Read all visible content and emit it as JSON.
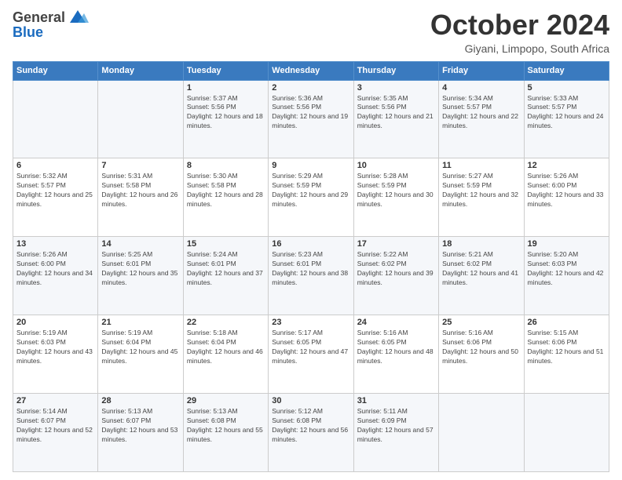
{
  "header": {
    "logo": {
      "line1": "General",
      "line2": "Blue"
    },
    "month": "October 2024",
    "location": "Giyani, Limpopo, South Africa"
  },
  "weekdays": [
    "Sunday",
    "Monday",
    "Tuesday",
    "Wednesday",
    "Thursday",
    "Friday",
    "Saturday"
  ],
  "weeks": [
    [
      null,
      null,
      {
        "day": 1,
        "sunrise": "5:37 AM",
        "sunset": "5:56 PM",
        "daylight": "12 hours and 18 minutes."
      },
      {
        "day": 2,
        "sunrise": "5:36 AM",
        "sunset": "5:56 PM",
        "daylight": "12 hours and 19 minutes."
      },
      {
        "day": 3,
        "sunrise": "5:35 AM",
        "sunset": "5:56 PM",
        "daylight": "12 hours and 21 minutes."
      },
      {
        "day": 4,
        "sunrise": "5:34 AM",
        "sunset": "5:57 PM",
        "daylight": "12 hours and 22 minutes."
      },
      {
        "day": 5,
        "sunrise": "5:33 AM",
        "sunset": "5:57 PM",
        "daylight": "12 hours and 24 minutes."
      }
    ],
    [
      {
        "day": 6,
        "sunrise": "5:32 AM",
        "sunset": "5:57 PM",
        "daylight": "12 hours and 25 minutes."
      },
      {
        "day": 7,
        "sunrise": "5:31 AM",
        "sunset": "5:58 PM",
        "daylight": "12 hours and 26 minutes."
      },
      {
        "day": 8,
        "sunrise": "5:30 AM",
        "sunset": "5:58 PM",
        "daylight": "12 hours and 28 minutes."
      },
      {
        "day": 9,
        "sunrise": "5:29 AM",
        "sunset": "5:59 PM",
        "daylight": "12 hours and 29 minutes."
      },
      {
        "day": 10,
        "sunrise": "5:28 AM",
        "sunset": "5:59 PM",
        "daylight": "12 hours and 30 minutes."
      },
      {
        "day": 11,
        "sunrise": "5:27 AM",
        "sunset": "5:59 PM",
        "daylight": "12 hours and 32 minutes."
      },
      {
        "day": 12,
        "sunrise": "5:26 AM",
        "sunset": "6:00 PM",
        "daylight": "12 hours and 33 minutes."
      }
    ],
    [
      {
        "day": 13,
        "sunrise": "5:26 AM",
        "sunset": "6:00 PM",
        "daylight": "12 hours and 34 minutes."
      },
      {
        "day": 14,
        "sunrise": "5:25 AM",
        "sunset": "6:01 PM",
        "daylight": "12 hours and 35 minutes."
      },
      {
        "day": 15,
        "sunrise": "5:24 AM",
        "sunset": "6:01 PM",
        "daylight": "12 hours and 37 minutes."
      },
      {
        "day": 16,
        "sunrise": "5:23 AM",
        "sunset": "6:01 PM",
        "daylight": "12 hours and 38 minutes."
      },
      {
        "day": 17,
        "sunrise": "5:22 AM",
        "sunset": "6:02 PM",
        "daylight": "12 hours and 39 minutes."
      },
      {
        "day": 18,
        "sunrise": "5:21 AM",
        "sunset": "6:02 PM",
        "daylight": "12 hours and 41 minutes."
      },
      {
        "day": 19,
        "sunrise": "5:20 AM",
        "sunset": "6:03 PM",
        "daylight": "12 hours and 42 minutes."
      }
    ],
    [
      {
        "day": 20,
        "sunrise": "5:19 AM",
        "sunset": "6:03 PM",
        "daylight": "12 hours and 43 minutes."
      },
      {
        "day": 21,
        "sunrise": "5:19 AM",
        "sunset": "6:04 PM",
        "daylight": "12 hours and 45 minutes."
      },
      {
        "day": 22,
        "sunrise": "5:18 AM",
        "sunset": "6:04 PM",
        "daylight": "12 hours and 46 minutes."
      },
      {
        "day": 23,
        "sunrise": "5:17 AM",
        "sunset": "6:05 PM",
        "daylight": "12 hours and 47 minutes."
      },
      {
        "day": 24,
        "sunrise": "5:16 AM",
        "sunset": "6:05 PM",
        "daylight": "12 hours and 48 minutes."
      },
      {
        "day": 25,
        "sunrise": "5:16 AM",
        "sunset": "6:06 PM",
        "daylight": "12 hours and 50 minutes."
      },
      {
        "day": 26,
        "sunrise": "5:15 AM",
        "sunset": "6:06 PM",
        "daylight": "12 hours and 51 minutes."
      }
    ],
    [
      {
        "day": 27,
        "sunrise": "5:14 AM",
        "sunset": "6:07 PM",
        "daylight": "12 hours and 52 minutes."
      },
      {
        "day": 28,
        "sunrise": "5:13 AM",
        "sunset": "6:07 PM",
        "daylight": "12 hours and 53 minutes."
      },
      {
        "day": 29,
        "sunrise": "5:13 AM",
        "sunset": "6:08 PM",
        "daylight": "12 hours and 55 minutes."
      },
      {
        "day": 30,
        "sunrise": "5:12 AM",
        "sunset": "6:08 PM",
        "daylight": "12 hours and 56 minutes."
      },
      {
        "day": 31,
        "sunrise": "5:11 AM",
        "sunset": "6:09 PM",
        "daylight": "12 hours and 57 minutes."
      },
      null,
      null
    ]
  ]
}
